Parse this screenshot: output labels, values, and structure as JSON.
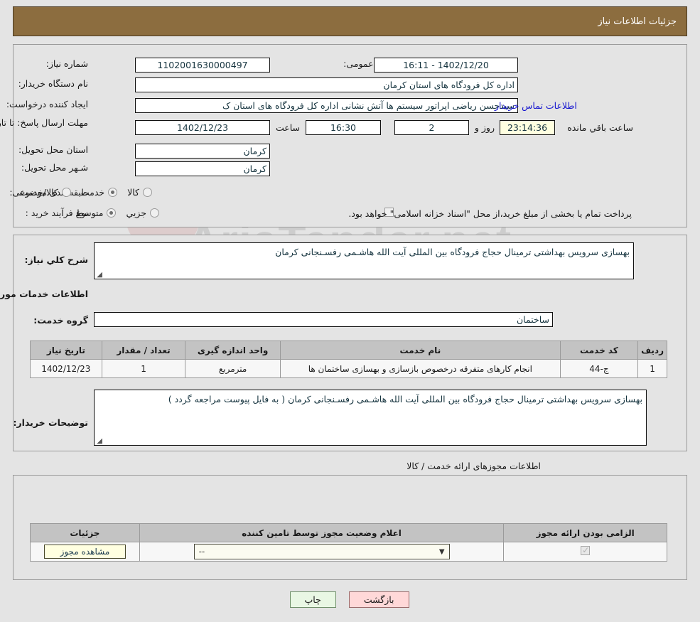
{
  "header": {
    "title": "جزئیات اطلاعات نیاز"
  },
  "top_form": {
    "need_number_label": "شماره نیاز:",
    "need_number_value": "1102001630000497",
    "announce_label": "تاریخ و ساعت اعلان عمومی:",
    "announce_value": "1402/12/20 - 16:11",
    "buyer_org_label": "نام دستگاه خریدار:",
    "buyer_org_value": "اداره کل فرودگاه های استان کرمان",
    "requester_label": "ایجاد کننده درخواست:",
    "requester_value": "سیدحسن ریاضی اپراتور سیستم ها آتش نشانی اداره کل فرودگاه های استان ک",
    "contact_link": "اطلاعات تماس خریدار",
    "deadline_label": "مهلت ارسال پاسخ: تا تاریخ:",
    "deadline_date": "1402/12/23",
    "hour_label": "ساعت",
    "deadline_time": "16:30",
    "days_value": "2",
    "days_label": "روز و",
    "countdown_value": "23:14:36",
    "remaining_label": "ساعت باقي مانده",
    "province_label": "استان محل تحویل:",
    "province_value": "کرمان",
    "city_label": "شـهر محل تحویل:",
    "city_value": "کرمان",
    "category_label": "طبقه بندی موضوعی:",
    "category_options": [
      {
        "label": "کالا",
        "selected": false
      },
      {
        "label": "خدمت",
        "selected": true
      },
      {
        "label": "کالا/خدمت",
        "selected": false
      }
    ],
    "process_label": "نوع فرآیند خرید :",
    "process_options": [
      {
        "label": "جزیي",
        "selected": false
      },
      {
        "label": "متوسط",
        "selected": true
      }
    ],
    "payment_checkbox_checked": false,
    "payment_note": "پرداخت تمام یا بخشی از مبلغ خرید،از محل \"اسناد خزانه اسلامی\" خواهد بود."
  },
  "mid_form": {
    "summary_label": "شرح کلي نیاز:",
    "summary_value": "بهسازی سرویس بهداشتی ترمینال حجاج فرودگاه بین المللی آیت الله هاشـمی رفسـنجانی کرمان",
    "services_heading": "اطلاعات خدمات مورد نیاز",
    "service_group_label": "گروه خدمت:",
    "service_group_value": "ساختمان",
    "table": {
      "headers": [
        "ردیف",
        "کد خدمت",
        "نام خدمت",
        "واحد اندازه گیری",
        "تعداد / مقدار",
        "تاریخ نیاز"
      ],
      "rows": [
        {
          "row_no": "1",
          "service_code": "ج-44",
          "service_name": "انجام کارهای متفرقه درخصوص بازسازی و بهسازی ساختمان ها",
          "unit": "مترمربع",
          "quantity": "1",
          "need_date": "1402/12/23"
        }
      ]
    },
    "buyer_notes_label": "توضیحات خریدار:",
    "buyer_notes_value": "بهسازی سرویس بهداشتی ترمینال حجاج فرودگاه بین المللی آیت الله هاشـمی رفسـنجانی کرمان ( به فایل پیوست مراجعه گردد )"
  },
  "permits": {
    "section_label": "اطلاعات مجوزهای ارائه خدمت / کالا",
    "headers": [
      "الزامی بودن ارائه مجوز",
      "اعلام وضعیت مجوز توسط تامین کننده",
      "جزئیات"
    ],
    "rows": [
      {
        "required_checked": true,
        "status_value": "--",
        "details_button": "مشاهده مجوز"
      }
    ]
  },
  "footer": {
    "print_label": "چاپ",
    "return_label": "بازگشت"
  },
  "watermark": {
    "text": "AriaTender.net"
  }
}
